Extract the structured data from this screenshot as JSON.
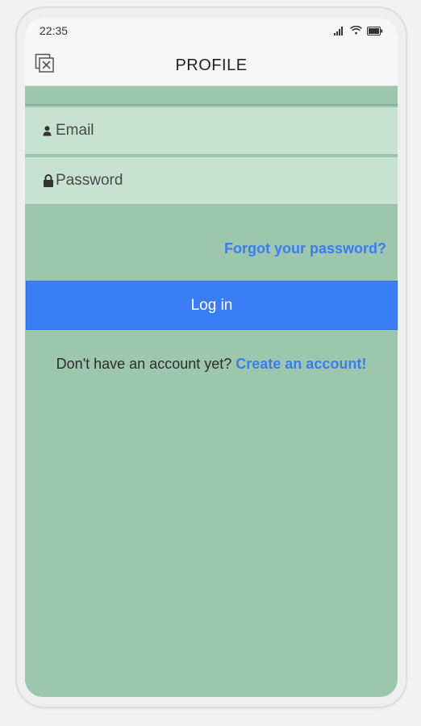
{
  "status_bar": {
    "time": "22:35",
    "icons": [
      "signal-icon",
      "wifi-icon",
      "battery-icon"
    ]
  },
  "header": {
    "close_icon": "close-icon",
    "title": "PROFILE"
  },
  "form": {
    "email": {
      "icon": "user-icon",
      "placeholder": "Email",
      "value": ""
    },
    "password": {
      "icon": "lock-icon",
      "placeholder": "Password",
      "value": ""
    },
    "forgot_label": "Forgot your password?",
    "login_label": "Log in"
  },
  "signup": {
    "prompt": "Don't have an account yet?",
    "link_label": "Create an account!"
  },
  "colors": {
    "background": "#9cc6ad",
    "field_background": "#c7e2d3",
    "accent": "#3b7df5",
    "link": "#3b7df0"
  }
}
